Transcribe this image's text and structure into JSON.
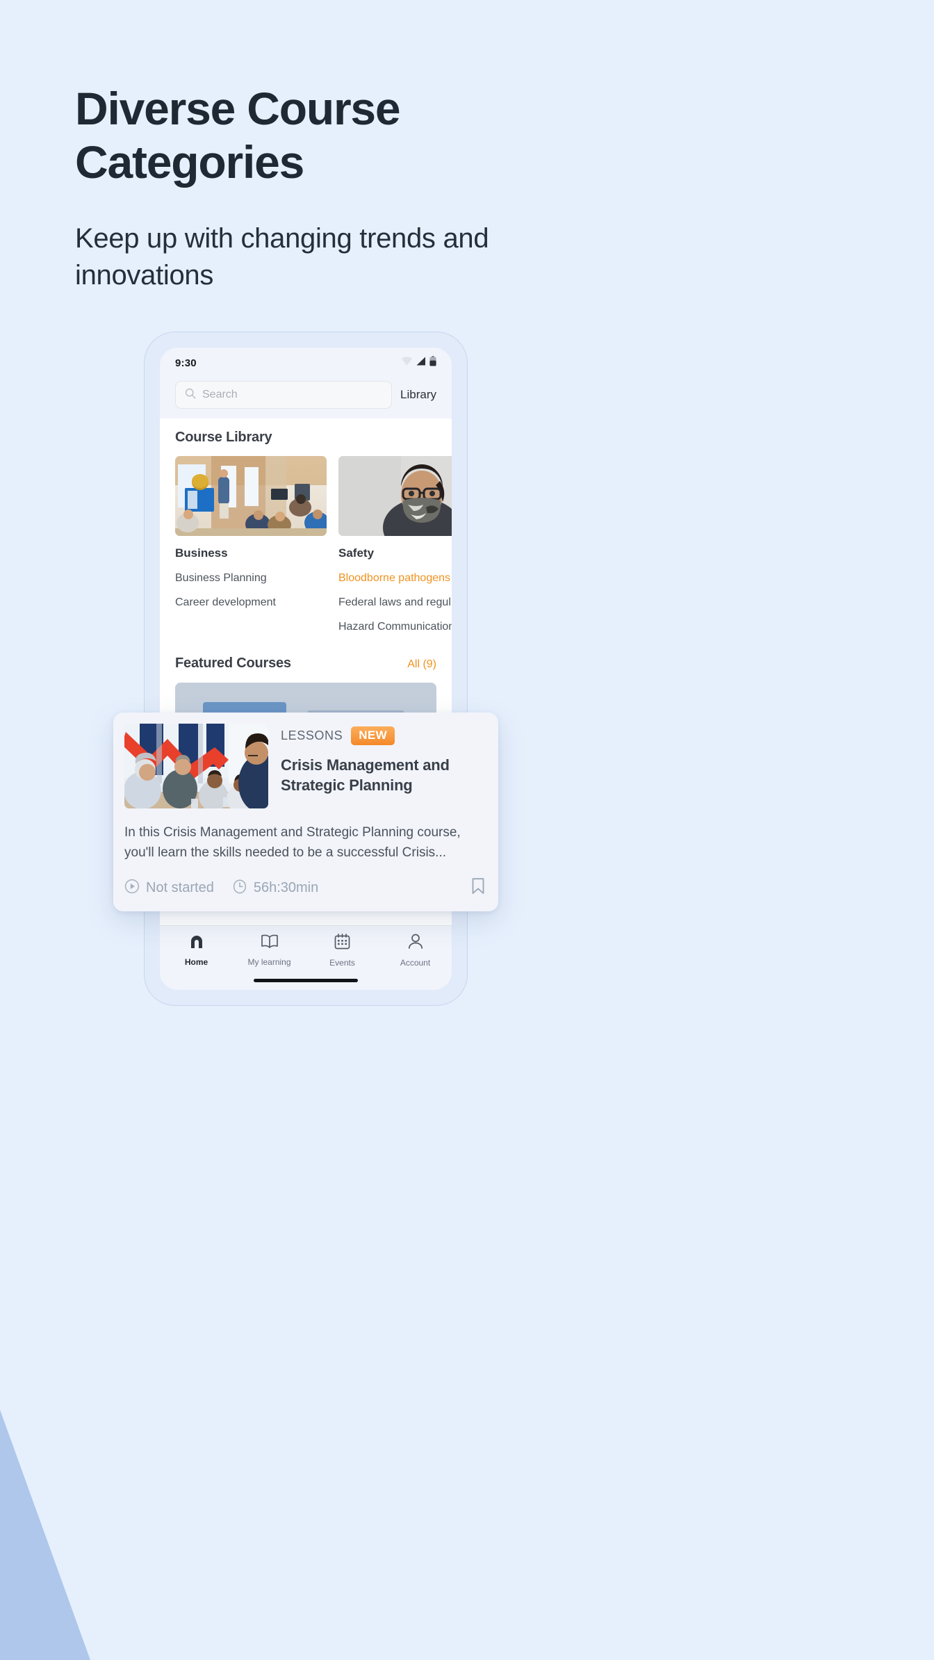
{
  "hero": {
    "title": "Diverse Course Categories",
    "subtitle": "Keep up with changing trends and innovations"
  },
  "colors": {
    "page_background": "#e6f0fd",
    "accent_orange": "#f0921f",
    "heading_text": "#1f2933",
    "wedge_blue": "#aec7ea"
  },
  "phone": {
    "status_bar": {
      "time": "9:30",
      "icons": [
        "wifi-icon",
        "cellular-signal-icon",
        "battery-icon"
      ]
    },
    "search": {
      "placeholder": "Search",
      "value": "",
      "icon": "search-icon"
    },
    "library_link": "Library",
    "course_library": {
      "section_title": "Course Library",
      "categories": [
        {
          "name": "Business",
          "thumbnail": "office-presentation-photo",
          "items": [
            {
              "label": "Business Planning",
              "highlighted": false
            },
            {
              "label": "Career development",
              "highlighted": false
            }
          ]
        },
        {
          "name": "Safety",
          "thumbnail": "person-wearing-face-mask-photo",
          "items": [
            {
              "label": "Bloodborne pathogens",
              "highlighted": true
            },
            {
              "label": "Federal laws and regul...",
              "highlighted": false
            },
            {
              "label": "Hazard Communication",
              "highlighted": false
            }
          ]
        }
      ]
    },
    "featured": {
      "section_title": "Featured Courses",
      "all_link": "All (9)"
    },
    "bottom_nav": [
      {
        "label": "Home",
        "icon": "home-icon",
        "active": true
      },
      {
        "label": "My learning",
        "icon": "book-icon",
        "active": false
      },
      {
        "label": "Events",
        "icon": "calendar-icon",
        "active": false
      },
      {
        "label": "Account",
        "icon": "person-icon",
        "active": false
      }
    ]
  },
  "course_card": {
    "thumbnail": "business-meeting-photo",
    "kicker": "LESSONS",
    "badge": "NEW",
    "title": "Crisis Management and Strategic Planning",
    "description": "In this Crisis Management and Strategic Planning course, you'll learn the skills needed to be a successful Crisis...",
    "status": {
      "icon": "play-circle-icon",
      "label": "Not started"
    },
    "duration": {
      "icon": "clock-icon",
      "label": "56h:30min"
    },
    "bookmark_icon": "bookmark-icon"
  }
}
